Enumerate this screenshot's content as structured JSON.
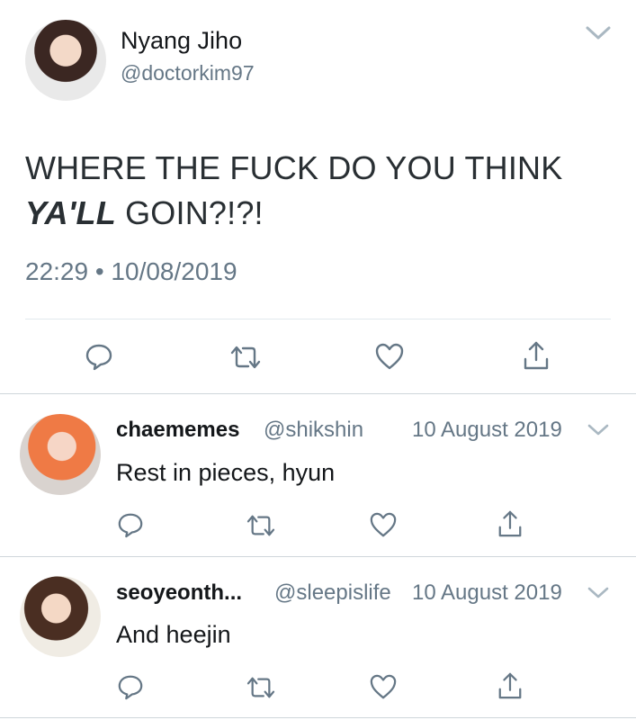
{
  "main_tweet": {
    "display_name": "Nyang Jiho",
    "handle": "@doctorkim97",
    "text_line1": "WHERE THE FUCK DO YOU THINK",
    "text_line2_emphasis": "YA'LL",
    "text_line2_rest": " GOIN?!?!",
    "timestamp": "22:29 • 10/08/2019",
    "actions": [
      "reply-icon",
      "retweet-icon",
      "like-icon",
      "share-icon"
    ]
  },
  "replies": [
    {
      "display_name": "chaememes",
      "handle": "@shikshin",
      "date": "10 August 2019",
      "text": "Rest in pieces, hyun"
    },
    {
      "display_name": "seoyeonth...",
      "handle": "@sleepislife",
      "date": "10 August 2019",
      "text": "And heejin"
    }
  ],
  "colors": {
    "text_primary": "#14171a",
    "text_secondary": "#657786",
    "icon": "#657786",
    "divider": "#e1e8ed"
  }
}
